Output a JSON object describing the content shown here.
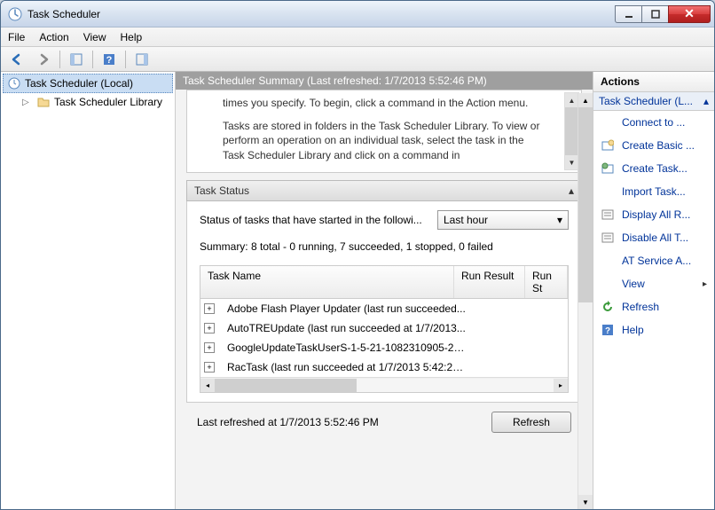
{
  "title": "Task Scheduler",
  "menubar": [
    "File",
    "Action",
    "View",
    "Help"
  ],
  "tree": {
    "root": "Task Scheduler (Local)",
    "child": "Task Scheduler Library"
  },
  "summary_header": "Task Scheduler Summary (Last refreshed: 1/7/2013 5:52:46 PM)",
  "overview": {
    "p1": "times you specify. To begin, click a command in the Action menu.",
    "p2": "Tasks are stored in folders in the Task Scheduler Library. To view or perform an operation on an individual task, select the task in the Task Scheduler Library and click on a command in"
  },
  "task_status": {
    "header": "Task Status",
    "label": "Status of tasks that have started in the followi...",
    "dropdown": "Last hour",
    "summary": "Summary: 8 total - 0 running, 7 succeeded, 1 stopped, 0 failed",
    "columns": [
      "Task Name",
      "Run Result",
      "Run St"
    ],
    "rows": [
      "Adobe Flash Player Updater (last run succeeded...",
      "AutoTREUpdate (last run succeeded at 1/7/2013...",
      "GoogleUpdateTaskUserS-1-5-21-1082310905-24...",
      "RacTask (last run succeeded at 1/7/2013 5:42:24 ..."
    ]
  },
  "footer": {
    "text": "Last refreshed at 1/7/2013 5:52:46 PM",
    "refresh": "Refresh"
  },
  "actions": {
    "header": "Actions",
    "group": "Task Scheduler (L...",
    "items": [
      "Connect to ...",
      "Create Basic ...",
      "Create Task...",
      "Import Task...",
      "Display All R...",
      "Disable All T...",
      "AT Service A...",
      "View",
      "Refresh",
      "Help"
    ]
  }
}
